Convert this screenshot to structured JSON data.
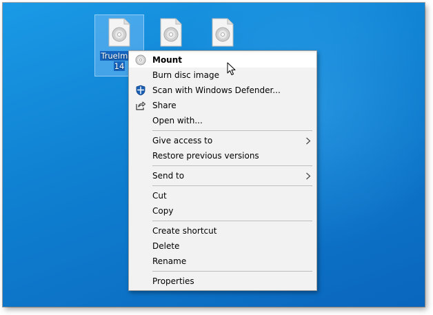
{
  "desktop": {
    "icons": [
      {
        "label_line1": "TrueImag",
        "label_line2": "14",
        "selected": true
      },
      {
        "label_line1": "",
        "label_line2": "",
        "selected": false
      },
      {
        "label_line1": "",
        "label_line2": "",
        "selected": false
      }
    ]
  },
  "context_menu": {
    "mount": "Mount",
    "burn_disc_image": "Burn disc image",
    "scan_defender": "Scan with Windows Defender...",
    "share": "Share",
    "open_with": "Open with...",
    "give_access_to": "Give access to",
    "restore_previous_versions": "Restore previous versions",
    "send_to": "Send to",
    "cut": "Cut",
    "copy": "Copy",
    "create_shortcut": "Create shortcut",
    "delete": "Delete",
    "rename": "Rename",
    "properties": "Properties",
    "submenu_arrow": "›"
  },
  "colors": {
    "desktop_blue": "#0f7fd0",
    "menu_background": "#f2f2f2",
    "defender_blue": "#1a5fb4"
  },
  "icons": {
    "disc_file": "disc-image-file-icon",
    "disc": "disc-icon",
    "shield": "windows-defender-shield-icon",
    "share": "share-icon",
    "cursor": "mouse-cursor-icon"
  }
}
